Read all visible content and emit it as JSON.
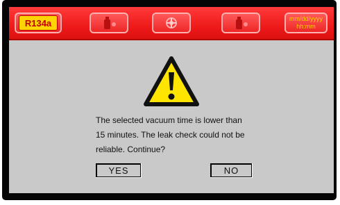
{
  "header": {
    "gas_label": "R134a",
    "icons": [
      "cylinder-icon",
      "fan-icon",
      "cylinder-icon"
    ],
    "date_format": "mm/dd/yyyy",
    "time_format": "hh:mm"
  },
  "dialog": {
    "icon": "warning-icon",
    "message_lines": [
      "The selected vacuum time is lower than",
      "15 minutes. The leak check could not be",
      "reliable. Continue?"
    ],
    "yes_label": "YES",
    "no_label": "NO"
  },
  "colors": {
    "header_red": "#ee1a1a",
    "badge_yellow": "#ffd400",
    "background_gray": "#c9c9c9",
    "warning_yellow": "#ffe400"
  }
}
